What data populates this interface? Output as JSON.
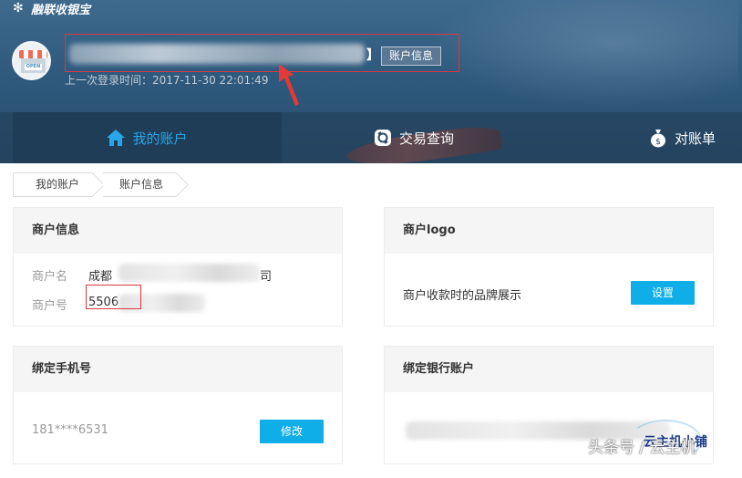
{
  "app": {
    "logo_text": "融联收银宝"
  },
  "header": {
    "bracket": "】",
    "account_info_button": "账户信息",
    "last_login": "上一次登录时间：2017-11-30 22:01:49"
  },
  "nav": {
    "tabs": [
      {
        "label": "我的账户",
        "icon": "home-icon",
        "active": true
      },
      {
        "label": "交易查询",
        "icon": "search-record-icon",
        "active": false
      },
      {
        "label": "对账单",
        "icon": "money-bag-icon",
        "active": false
      }
    ]
  },
  "breadcrumb": {
    "items": [
      "我的账户",
      "账户信息"
    ]
  },
  "cards": {
    "merchant_info": {
      "title": "商户信息",
      "name_label": "商户名",
      "name_prefix": "成都",
      "name_suffix": "司",
      "number_label": "商户号",
      "number_prefix": "5506"
    },
    "merchant_logo": {
      "title": "商户logo",
      "desc": "商户收款时的品牌展示",
      "button": "设置"
    },
    "phone": {
      "title": "绑定手机号",
      "value": "181****6531",
      "button": "修改"
    },
    "bank": {
      "title": "绑定银行账户"
    }
  },
  "watermark": {
    "text": "头条号 / 云主机",
    "brand": "云主机小铺"
  },
  "colors": {
    "accent": "#10aee9",
    "active_tab_text": "#2aa6e8",
    "highlight": "#d9373e"
  }
}
